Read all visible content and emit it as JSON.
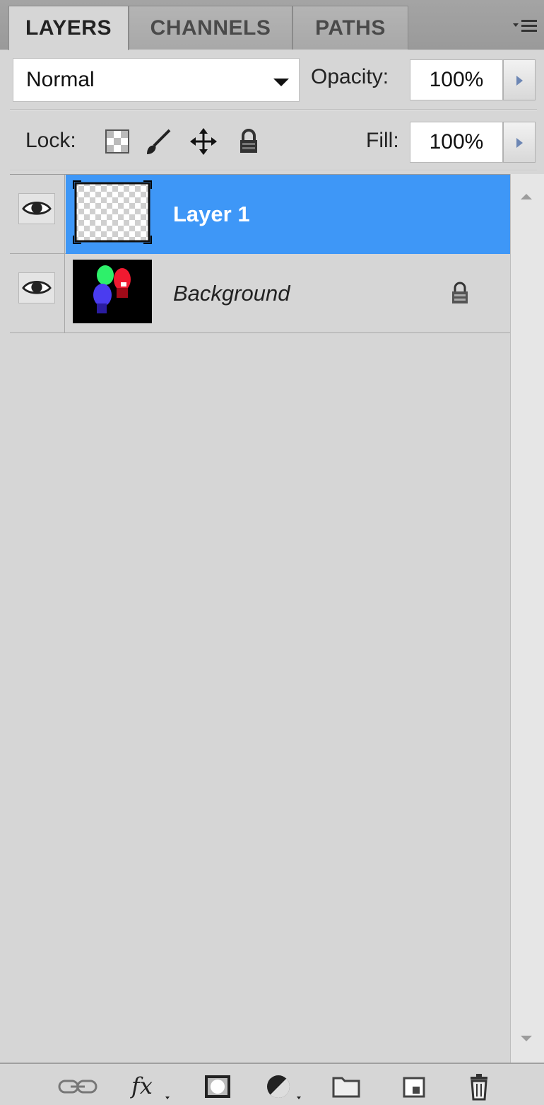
{
  "tabs": [
    {
      "label": "LAYERS",
      "active": true
    },
    {
      "label": "CHANNELS",
      "active": false
    },
    {
      "label": "PATHS",
      "active": false
    }
  ],
  "panel_menu_icon": "panel-menu-icon",
  "blend_mode": {
    "value": "Normal"
  },
  "opacity": {
    "label": "Opacity:",
    "value": "100%"
  },
  "lock": {
    "label": "Lock:",
    "icons": [
      "lock-transparent-pixels-icon",
      "lock-image-pixels-icon",
      "lock-position-icon",
      "lock-all-icon"
    ]
  },
  "fill": {
    "label": "Fill:",
    "value": "100%"
  },
  "layers": [
    {
      "name": "Layer 1",
      "selected": true,
      "visible": true,
      "locked": false,
      "thumbnail": "transparent"
    },
    {
      "name": "Background",
      "selected": false,
      "visible": true,
      "locked": true,
      "thumbnail": "rgb-leds"
    }
  ],
  "colors": {
    "selection": "#3e97f7",
    "panel_bg": "#d6d6d6"
  },
  "toolbar_icons": [
    "link-layers-icon",
    "layer-style-icon",
    "layer-mask-icon",
    "adjustment-layer-icon",
    "new-group-icon",
    "new-layer-icon",
    "delete-layer-icon"
  ]
}
